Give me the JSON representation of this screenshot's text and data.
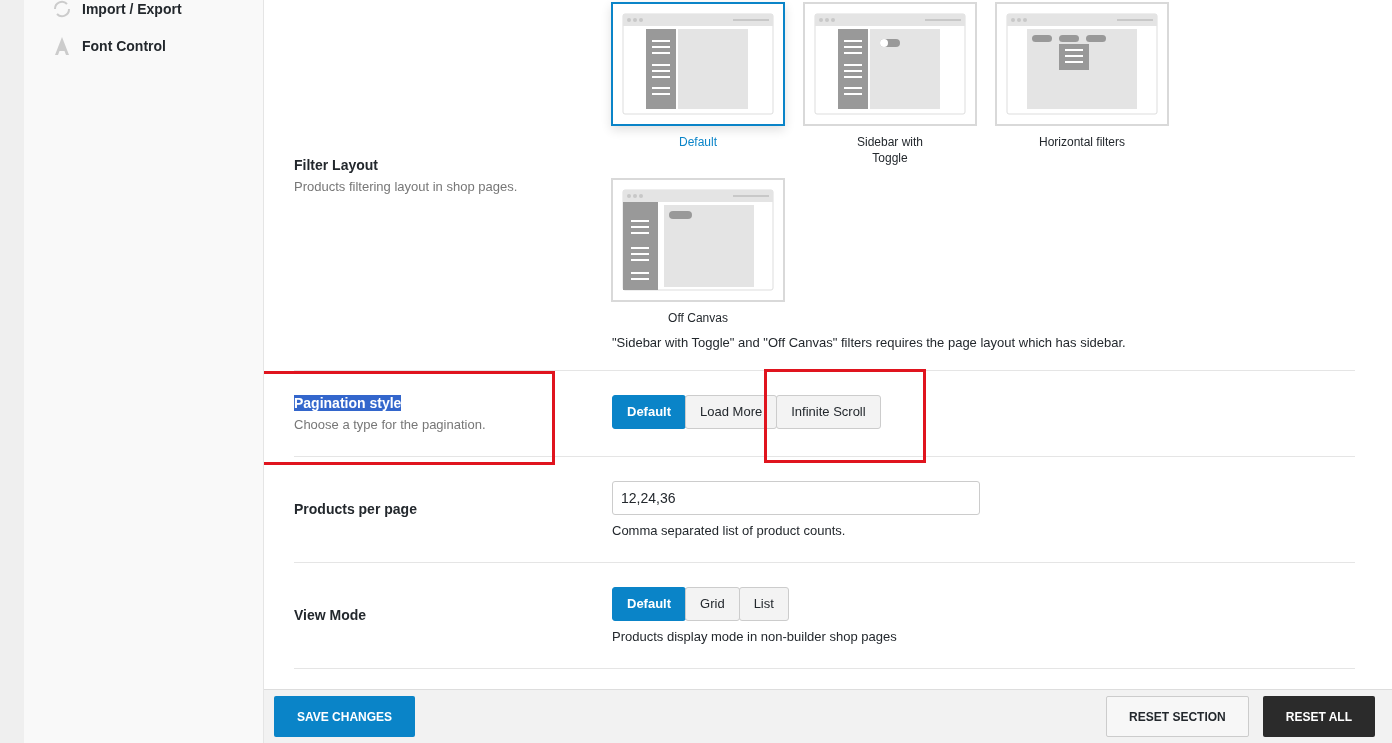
{
  "sidebar": {
    "items": [
      {
        "label": "Import / Export",
        "kind": "sync"
      },
      {
        "label": "Font Control",
        "kind": "font"
      }
    ]
  },
  "settings": [
    {
      "kind": "images",
      "title": "Filter Layout",
      "description": "Products filtering layout in shop pages.",
      "marked": false,
      "text_selected": false,
      "options": [
        {
          "label": "Default",
          "kind": "sidebar",
          "selected": true
        },
        {
          "label": "Sidebar with Toggle",
          "kind": "toggle",
          "selected": false
        },
        {
          "label": "Horizontal filters",
          "kind": "horizontal",
          "selected": false
        },
        {
          "label": "Off Canvas",
          "kind": "offcanvas",
          "selected": false
        }
      ],
      "note": "\"Sidebar with Toggle\" and \"Off Canvas\" filters requires the page layout which has sidebar."
    },
    {
      "kind": "buttons",
      "title": "Pagination style",
      "description": "Choose a type for the pagination.",
      "marked": true,
      "text_selected": true,
      "options": [
        {
          "label": "Default",
          "selected": true,
          "marked": false
        },
        {
          "label": "Load More",
          "selected": false,
          "marked": false
        },
        {
          "label": "Infinite Scroll",
          "selected": false,
          "marked": true
        }
      ]
    },
    {
      "kind": "text",
      "title": "Products per page",
      "value": "12,24,36",
      "note": "Comma separated list of product counts.",
      "marked": false,
      "text_selected": false
    },
    {
      "kind": "buttons",
      "title": "View Mode",
      "marked": false,
      "text_selected": false,
      "options": [
        {
          "label": "Default",
          "selected": true,
          "marked": false
        },
        {
          "label": "Grid",
          "selected": false,
          "marked": false
        },
        {
          "label": "List",
          "selected": false,
          "marked": false
        }
      ],
      "note": "Products display mode in non-builder shop pages"
    }
  ],
  "footer": {
    "save": "SAVE CHANGES",
    "reset_section": "RESET SECTION",
    "reset_all": "RESET ALL"
  }
}
